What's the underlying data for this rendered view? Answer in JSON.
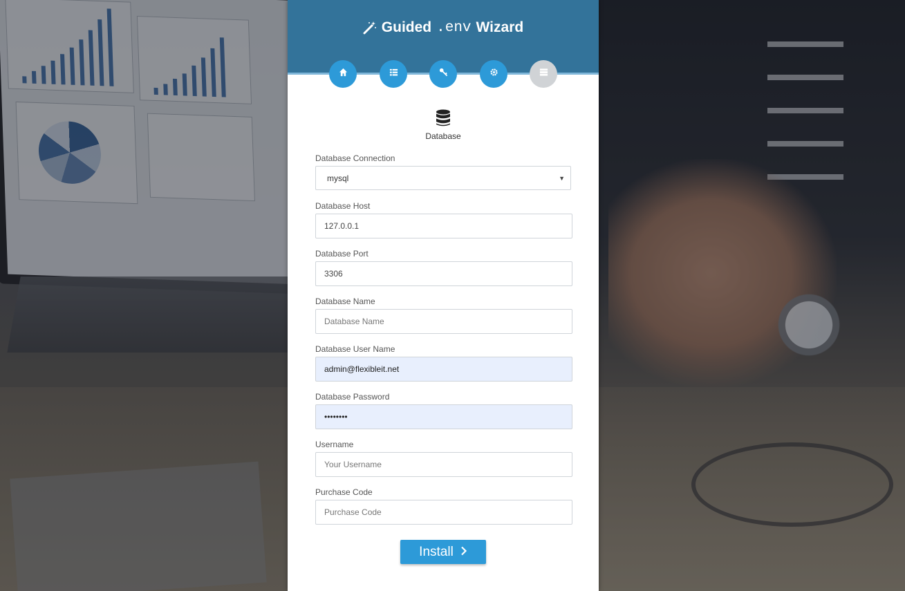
{
  "header": {
    "title_prefix": "Guided",
    "title_code": ".env",
    "title_suffix": "Wizard"
  },
  "steps": [
    {
      "icon": "home-icon"
    },
    {
      "icon": "list-icon"
    },
    {
      "icon": "key-icon"
    },
    {
      "icon": "gear-icon"
    },
    {
      "icon": "server-icon",
      "active": true
    }
  ],
  "section": {
    "icon": "database-icon",
    "label": "Database"
  },
  "form": {
    "connection": {
      "label": "Database Connection",
      "value": "mysql"
    },
    "host": {
      "label": "Database Host",
      "value": "127.0.0.1",
      "placeholder": ""
    },
    "port": {
      "label": "Database Port",
      "value": "3306",
      "placeholder": ""
    },
    "name": {
      "label": "Database Name",
      "value": "",
      "placeholder": "Database Name"
    },
    "user": {
      "label": "Database User Name",
      "value": "admin@flexibleit.net",
      "placeholder": ""
    },
    "password": {
      "label": "Database Password",
      "value": "12345678",
      "placeholder": ""
    },
    "username": {
      "label": "Username",
      "value": "",
      "placeholder": "Your Username"
    },
    "purchase": {
      "label": "Purchase Code",
      "value": "",
      "placeholder": "Purchase Code"
    }
  },
  "install_button": {
    "label": "Install"
  },
  "colors": {
    "header": "#33739a",
    "accent": "#2d9ad8",
    "inactive_step": "#d0d3d6",
    "autofill": "#e8effd"
  }
}
